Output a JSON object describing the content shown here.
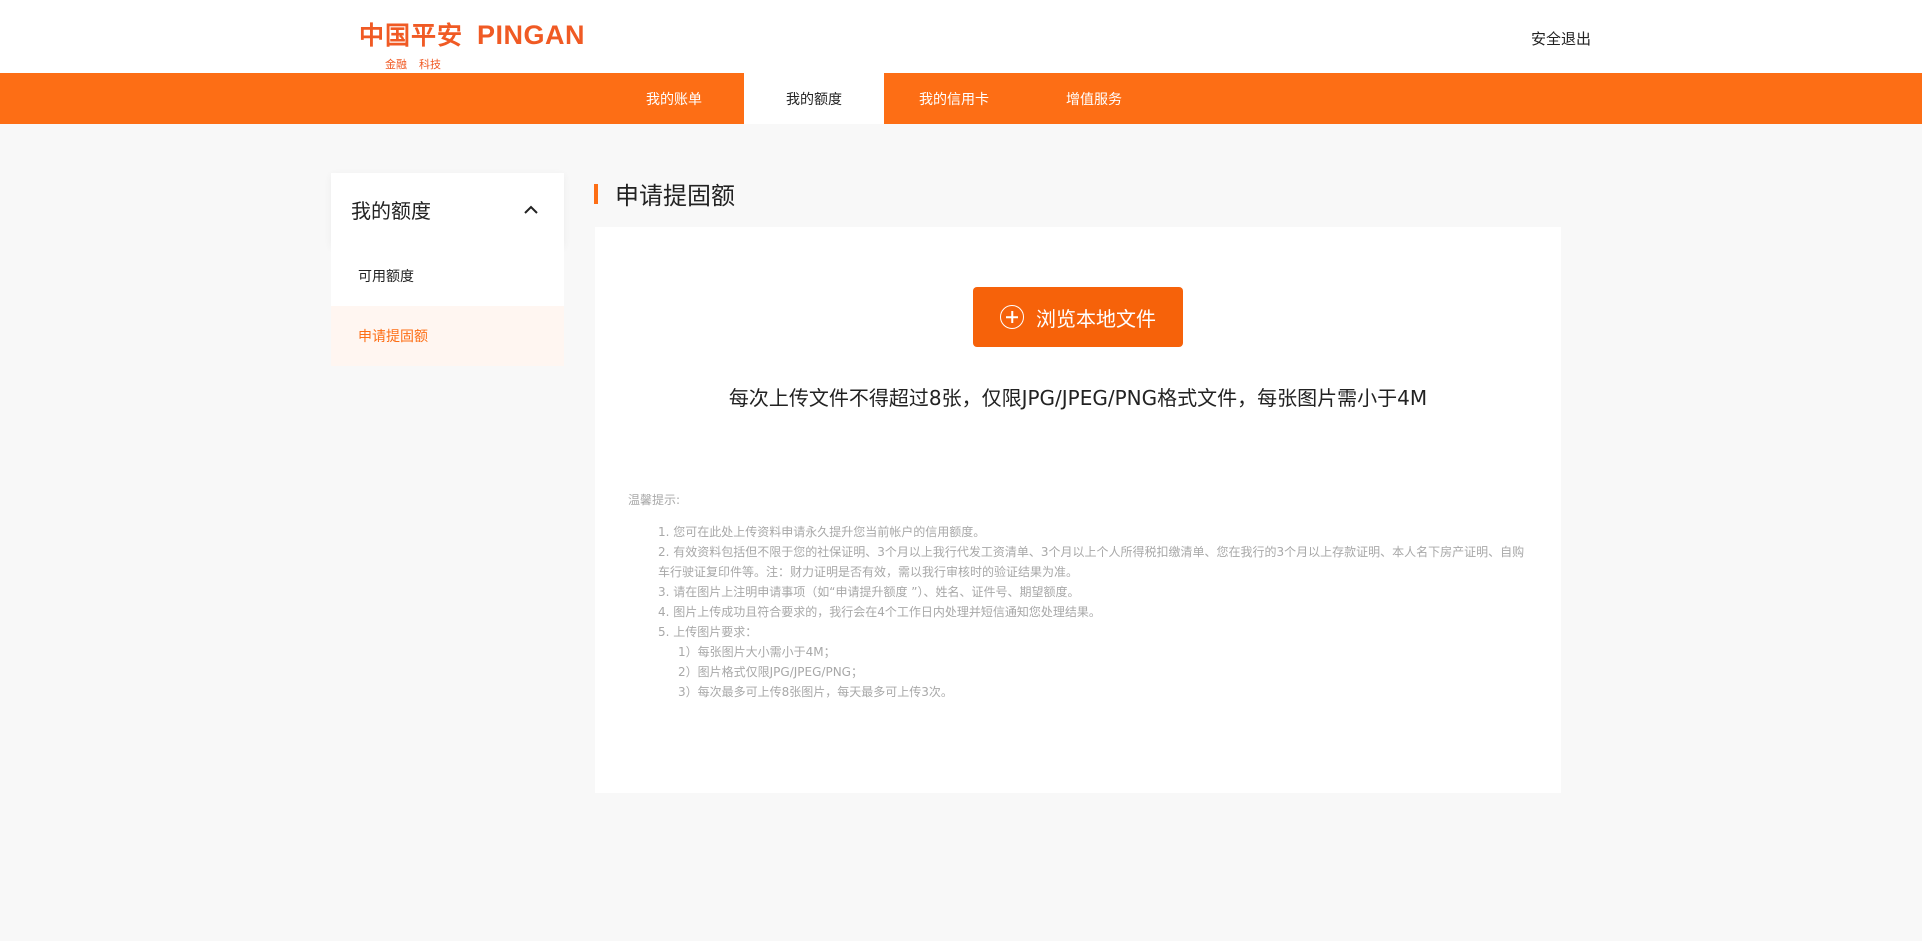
{
  "header": {
    "logo_cn": "中国平安",
    "logo_en": "PINGAN",
    "logo_sub_1": "金融",
    "logo_sub_2": "科技",
    "logout": "安全退出"
  },
  "nav": {
    "items": [
      {
        "label": "我的账单"
      },
      {
        "label": "我的额度"
      },
      {
        "label": "我的信用卡"
      },
      {
        "label": "增值服务"
      }
    ],
    "active_index": 1
  },
  "sidebar": {
    "title": "我的额度",
    "items": [
      {
        "label": "可用额度"
      },
      {
        "label": "申请提固额"
      }
    ],
    "active_index": 1
  },
  "main": {
    "title": "申请提固额",
    "upload_button": "浏览本地文件",
    "upload_note": "每次上传文件不得超过8张，仅限JPG/JPEG/PNG格式文件，每张图片需小于4M",
    "tips": {
      "title": "温馨提示:",
      "items": [
        "1. 您可在此处上传资料申请永久提升您当前帐户的信用额度。",
        "2. 有效资料包括但不限于您的社保证明、3个月以上我行代发工资清单、3个月以上个人所得税扣缴清单、您在我行的3个月以上存款证明、本人名下房产证明、自购",
        "车行驶证复印件等。注：财力证明是否有效，需以我行审核时的验证结果为准。",
        "3. 请在图片上注明申请事项（如“申请提升额度 ”）、姓名、证件号、期望额度。",
        "4. 图片上传成功且符合要求的，我行会在4个工作日内处理并短信通知您处理结果。",
        "5. 上传图片要求："
      ],
      "sub_items": [
        "1）每张图片大小需小于4M；",
        "2）图片格式仅限JPG/JPEG/PNG；",
        "3）每次最多可上传8张图片，每天最多可上传3次。"
      ]
    }
  },
  "colors": {
    "brand_orange": "#fd6e15",
    "button_orange": "#f6620a",
    "logo_orange": "#f05a24"
  }
}
